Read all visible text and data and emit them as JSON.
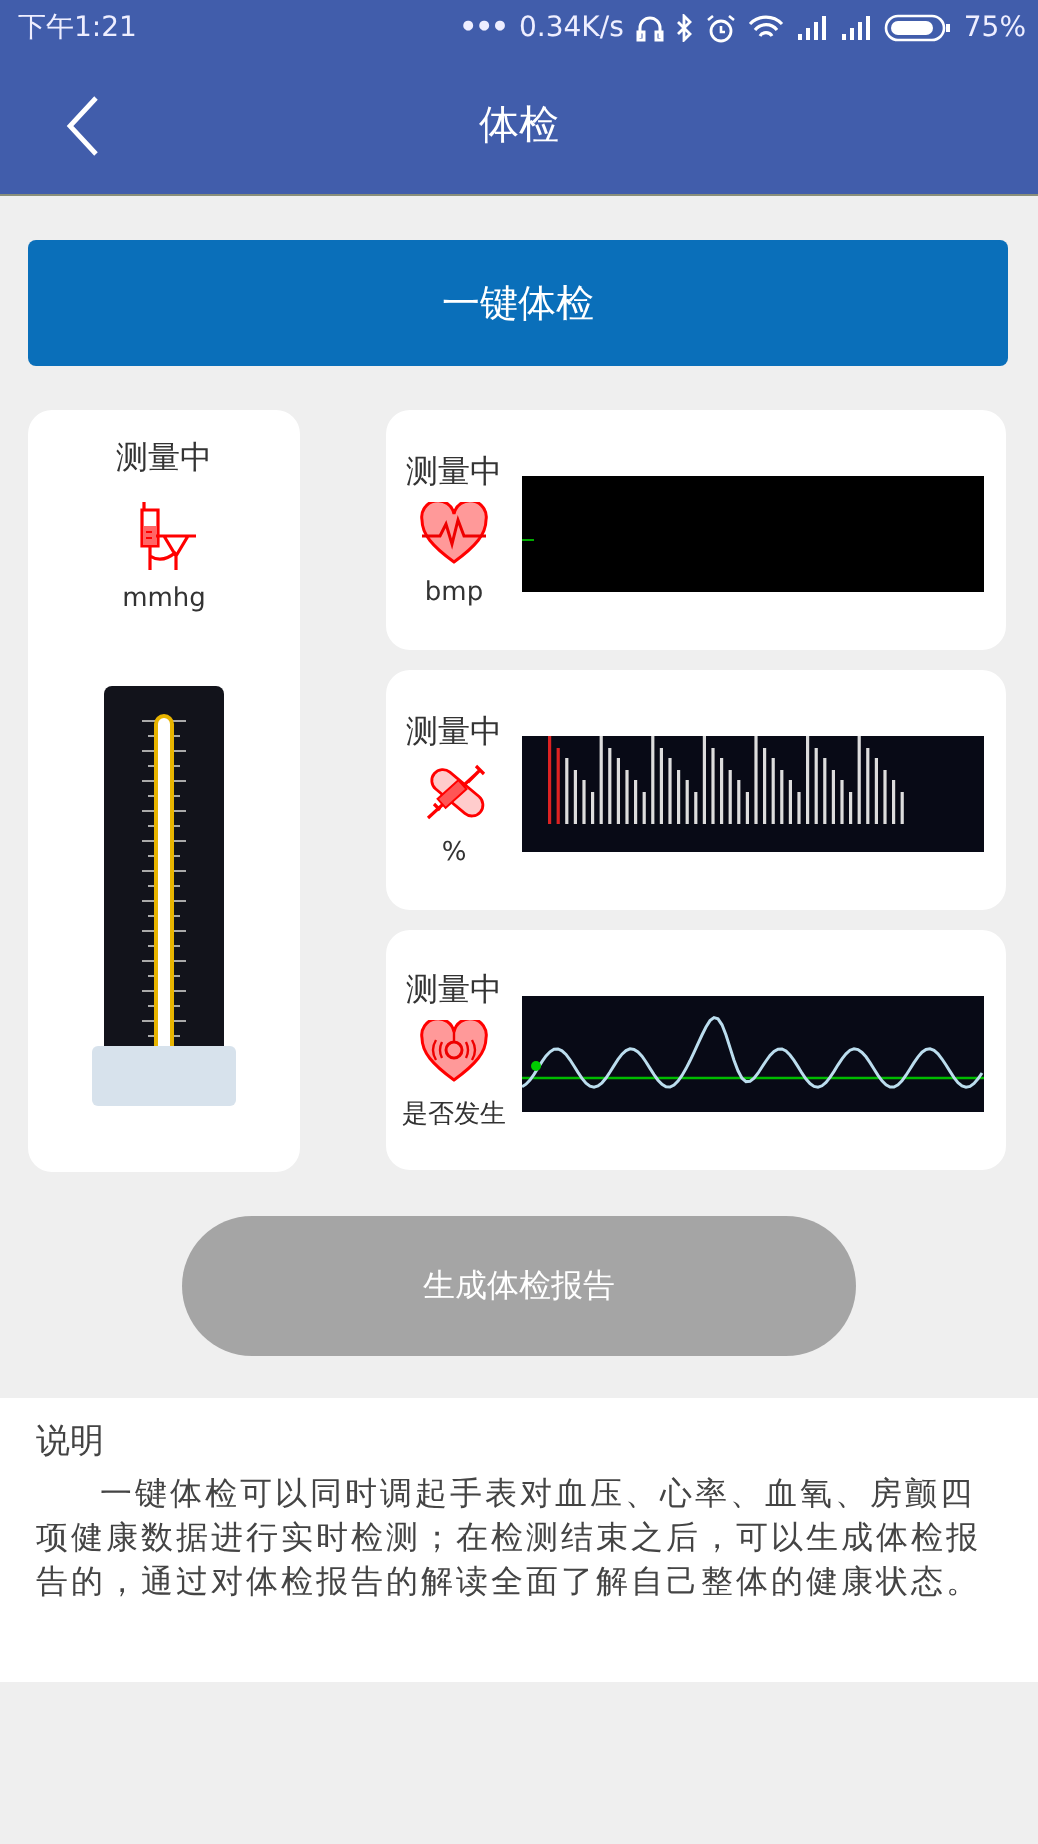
{
  "status_bar": {
    "time": "下午1:21",
    "more": "•••",
    "speed": "0.34K/s",
    "battery": "75%"
  },
  "header": {
    "title": "体检"
  },
  "one_key_button": "一键体检",
  "blood_pressure": {
    "status": "测量中",
    "unit": "mmhg"
  },
  "monitors": [
    {
      "kind": "ecg",
      "status": "测量中",
      "unit": "bmp"
    },
    {
      "kind": "bars",
      "status": "测量中",
      "unit": "%"
    },
    {
      "kind": "wave",
      "status": "测量中",
      "unit": "是否发生"
    }
  ],
  "report_button": {
    "label": "生成体检报告",
    "disabled": true
  },
  "description": {
    "title": "说明",
    "text": "一键体检可以同时调起手表对血压、心率、血氧、房颤四项健康数据进行实时检测；在检测结束之后，可以生成体检报告的，通过对体检报告的解读全面了解自己整体的健康状态。"
  }
}
